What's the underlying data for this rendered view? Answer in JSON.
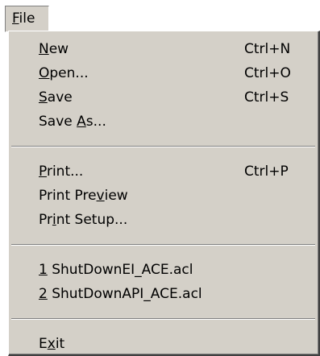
{
  "menubar": {
    "file_label": "File"
  },
  "menu": {
    "groups": [
      {
        "items": [
          {
            "label": "New",
            "shortcut": "Ctrl+N"
          },
          {
            "label": "Open...",
            "shortcut": "Ctrl+O"
          },
          {
            "label": "Save",
            "shortcut": "Ctrl+S"
          },
          {
            "label": "Save As..."
          }
        ]
      },
      {
        "items": [
          {
            "label": "Print...",
            "shortcut": "Ctrl+P"
          },
          {
            "label": "Print Preview"
          },
          {
            "label": "Print Setup..."
          }
        ]
      },
      {
        "items": [
          {
            "label": "1 ShutDownEI_ACE.acl"
          },
          {
            "label": "2 ShutDownAPI_ACE.acl"
          }
        ]
      },
      {
        "items": [
          {
            "label": "Exit"
          }
        ]
      }
    ]
  },
  "colors": {
    "menu_background": "#d4d0c8",
    "separator_dark": "#808080",
    "separator_light": "#ffffff",
    "text": "#000000"
  }
}
